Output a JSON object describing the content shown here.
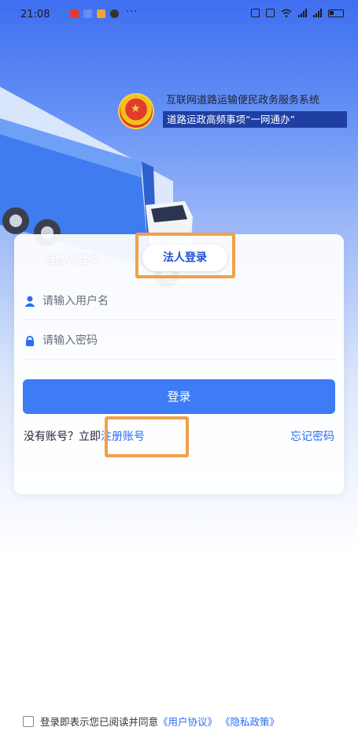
{
  "status_bar": {
    "time": "21:08",
    "more": "···"
  },
  "header": {
    "title": "互联网道路运输便民政务服务系统",
    "subtitle": "道路运政高频事项“一网通办”"
  },
  "login": {
    "tabs": [
      {
        "label": "自然人登录",
        "selected": false
      },
      {
        "label": "法人登录",
        "selected": true
      }
    ],
    "username_placeholder": "请输入用户名",
    "password_placeholder": "请输入密码",
    "submit_label": "登录",
    "no_account_text": "没有账号？立即",
    "register_label": "注册账号",
    "forgot_label": "忘记密码"
  },
  "agreement": {
    "prefix": "登录即表示您已阅读并同意",
    "user_agreement": "《用户协议》",
    "privacy_policy": "《隐私政策》"
  },
  "colors": {
    "accent": "#3d7cf5",
    "link": "#2a6df4",
    "highlight": "#f0a04b",
    "subtitle_bg": "#1f3fa3"
  }
}
